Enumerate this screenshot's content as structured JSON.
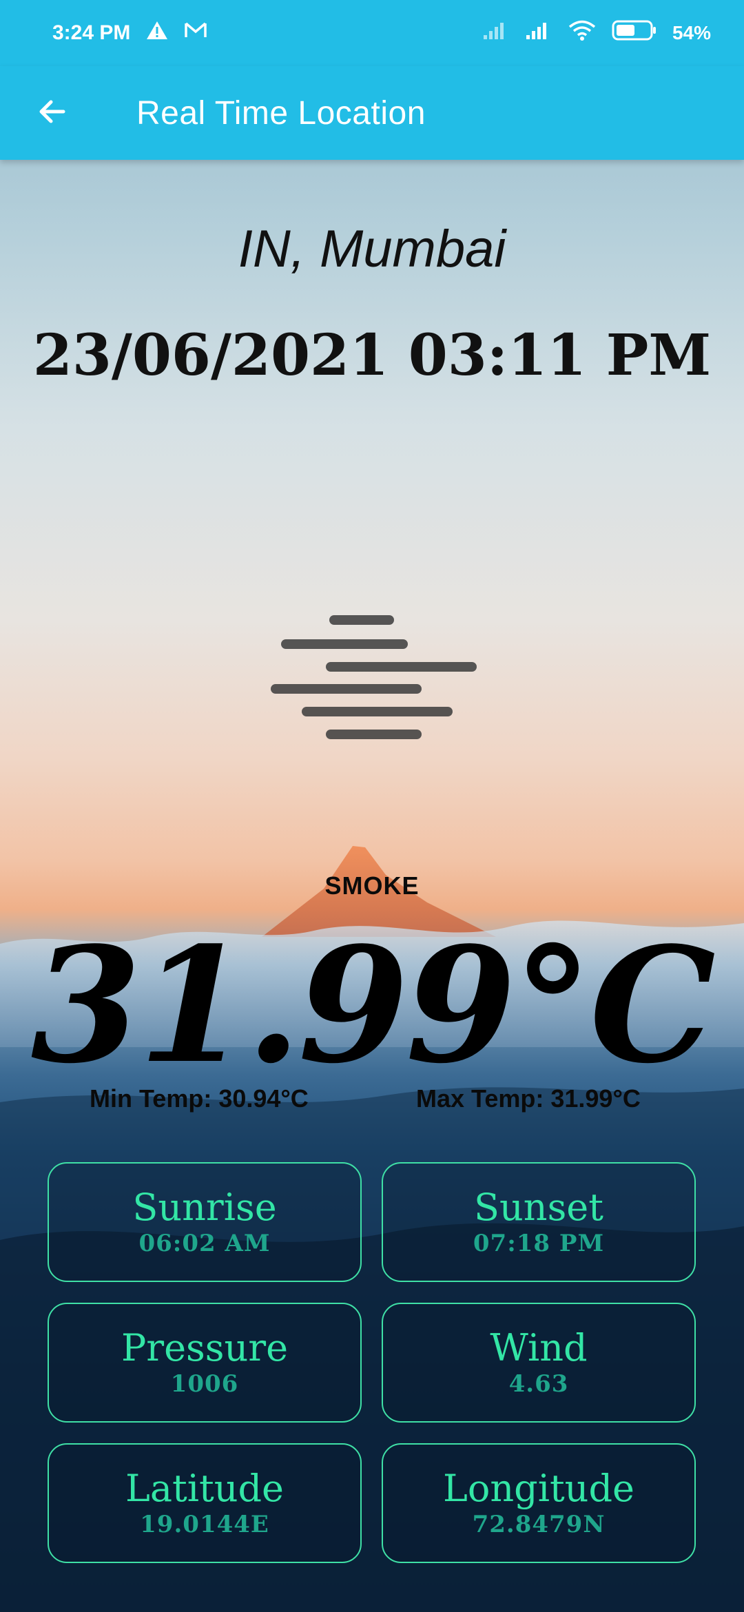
{
  "status_bar": {
    "time": "3:24 PM",
    "icons": [
      "warning-icon",
      "gmail-icon",
      "signal-icon",
      "signal-icon",
      "wifi-icon",
      "battery-icon"
    ],
    "battery": "54%"
  },
  "app_bar": {
    "back_icon": "arrow-back-icon",
    "title": "Real Time Location",
    "color": "#22bde6"
  },
  "weather": {
    "location": "IN, Mumbai",
    "datetime": "23/06/2021 03:11 PM",
    "icon": "haze-icon",
    "condition": "SMOKE",
    "temperature": "31.99°C",
    "min_temp": "Min Temp: 30.94°C",
    "max_temp": "Max Temp: 31.99°C"
  },
  "cards": [
    {
      "label": "Sunrise",
      "value": "06:02 AM"
    },
    {
      "label": "Sunset",
      "value": "07:18 PM"
    },
    {
      "label": "Pressure",
      "value": "1006"
    },
    {
      "label": "Wind",
      "value": "4.63"
    },
    {
      "label": "Latitude",
      "value": "19.0144E"
    },
    {
      "label": "Longitude",
      "value": "72.8479N"
    }
  ],
  "colors": {
    "card_border": "#3fe0a6",
    "card_label": "#33e6a6",
    "card_value": "#1fa68c"
  }
}
